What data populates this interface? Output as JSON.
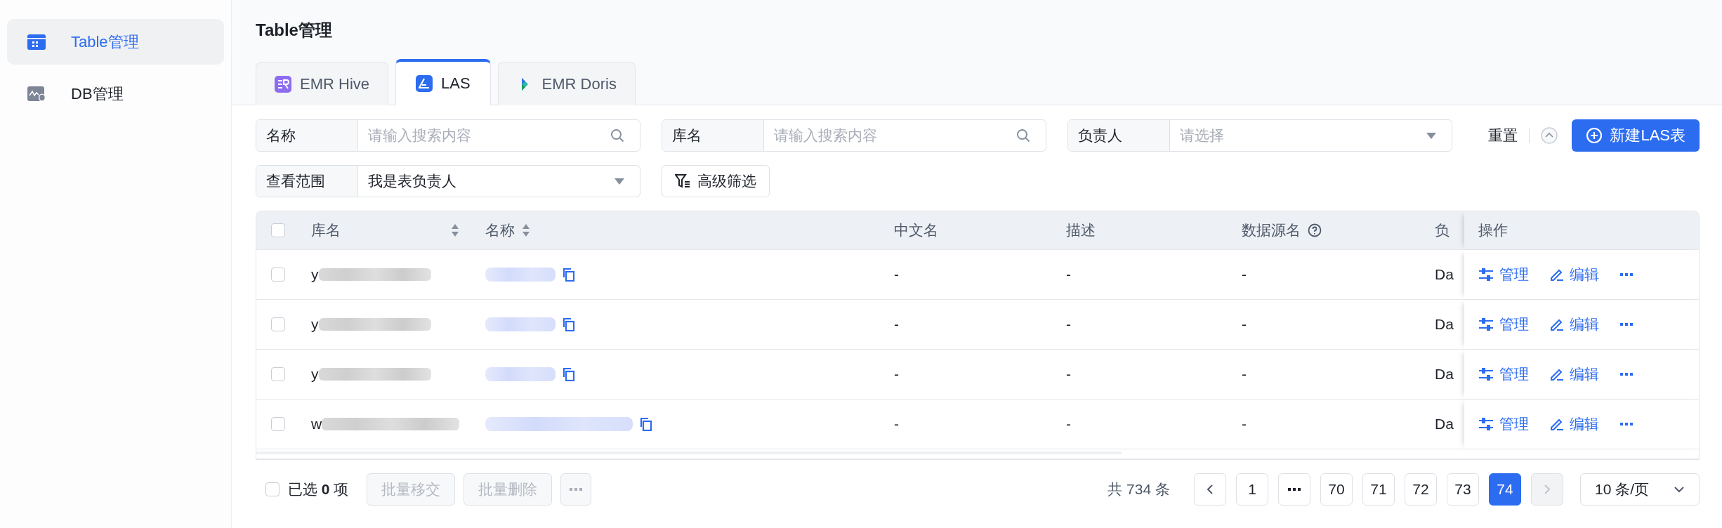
{
  "sidebar": {
    "items": [
      {
        "label": "Table管理",
        "selected": true
      },
      {
        "label": "DB管理",
        "selected": false
      }
    ]
  },
  "page_title": "Table管理",
  "tabs": [
    {
      "label": "EMR Hive",
      "selected": false
    },
    {
      "label": "LAS",
      "selected": true
    },
    {
      "label": "EMR Doris",
      "selected": false
    }
  ],
  "filters": {
    "rows": [
      [
        {
          "kind": "search",
          "label": "名称",
          "placeholder": "请输入搜索内容"
        },
        {
          "kind": "search",
          "label": "库名",
          "placeholder": "请输入搜索内容"
        },
        {
          "kind": "select",
          "label": "负责人",
          "placeholder": "请选择"
        }
      ],
      [
        {
          "kind": "select",
          "label": "查看范围",
          "value": "我是表负责人"
        },
        {
          "kind": "button",
          "label": "高级筛选"
        }
      ]
    ],
    "reset": "重置",
    "expanded": true,
    "create_button": "新建LAS表"
  },
  "table": {
    "header_checked": false,
    "columns": [
      {
        "kind": "sortable",
        "label": "库名"
      },
      {
        "kind": "sortable",
        "label": "名称"
      },
      {
        "kind": "plain",
        "label": "中文名"
      },
      {
        "kind": "plain",
        "label": "描述"
      },
      {
        "kind": "help",
        "label": "数据源名"
      },
      {
        "kind": "plain",
        "label": "负"
      },
      {
        "kind": "plain",
        "label": "操作"
      }
    ],
    "rows": [
      {
        "checked": false,
        "database": "y",
        "chinese_name": "-",
        "description": "-",
        "data_source": "-",
        "owner": "Da",
        "actions": [
          "管理",
          "编辑"
        ]
      },
      {
        "checked": false,
        "database": "y",
        "chinese_name": "-",
        "description": "-",
        "data_source": "-",
        "owner": "Da",
        "actions": [
          "管理",
          "编辑"
        ]
      },
      {
        "checked": false,
        "database": "y",
        "chinese_name": "-",
        "description": "-",
        "data_source": "-",
        "owner": "Da",
        "actions": [
          "管理",
          "编辑"
        ]
      },
      {
        "checked": false,
        "database": "w",
        "chinese_name": "-",
        "description": "-",
        "data_source": "-",
        "owner": "Da",
        "actions": [
          "管理",
          "编辑"
        ]
      }
    ]
  },
  "footer": {
    "select_all_checked": false,
    "selected_text": "已选 **0** 项",
    "batch_buttons": [
      {
        "label": "批量移交",
        "disabled": true
      },
      {
        "label": "批量删除",
        "disabled": true
      }
    ],
    "more_disabled": true
  },
  "pagination": {
    "total": "共 734 条",
    "prev_disabled": false,
    "pages": [
      {
        "kind": "page",
        "label": "1",
        "selected": false
      },
      {
        "kind": "ellipsis",
        "selected": false
      },
      {
        "kind": "page",
        "label": "70",
        "selected": false
      },
      {
        "kind": "page",
        "label": "71",
        "selected": false
      },
      {
        "kind": "page",
        "label": "72",
        "selected": false
      },
      {
        "kind": "page",
        "label": "73",
        "selected": false
      },
      {
        "kind": "page",
        "label": "74",
        "selected": true
      }
    ],
    "next_disabled": true,
    "page_size": "10 条/页"
  }
}
